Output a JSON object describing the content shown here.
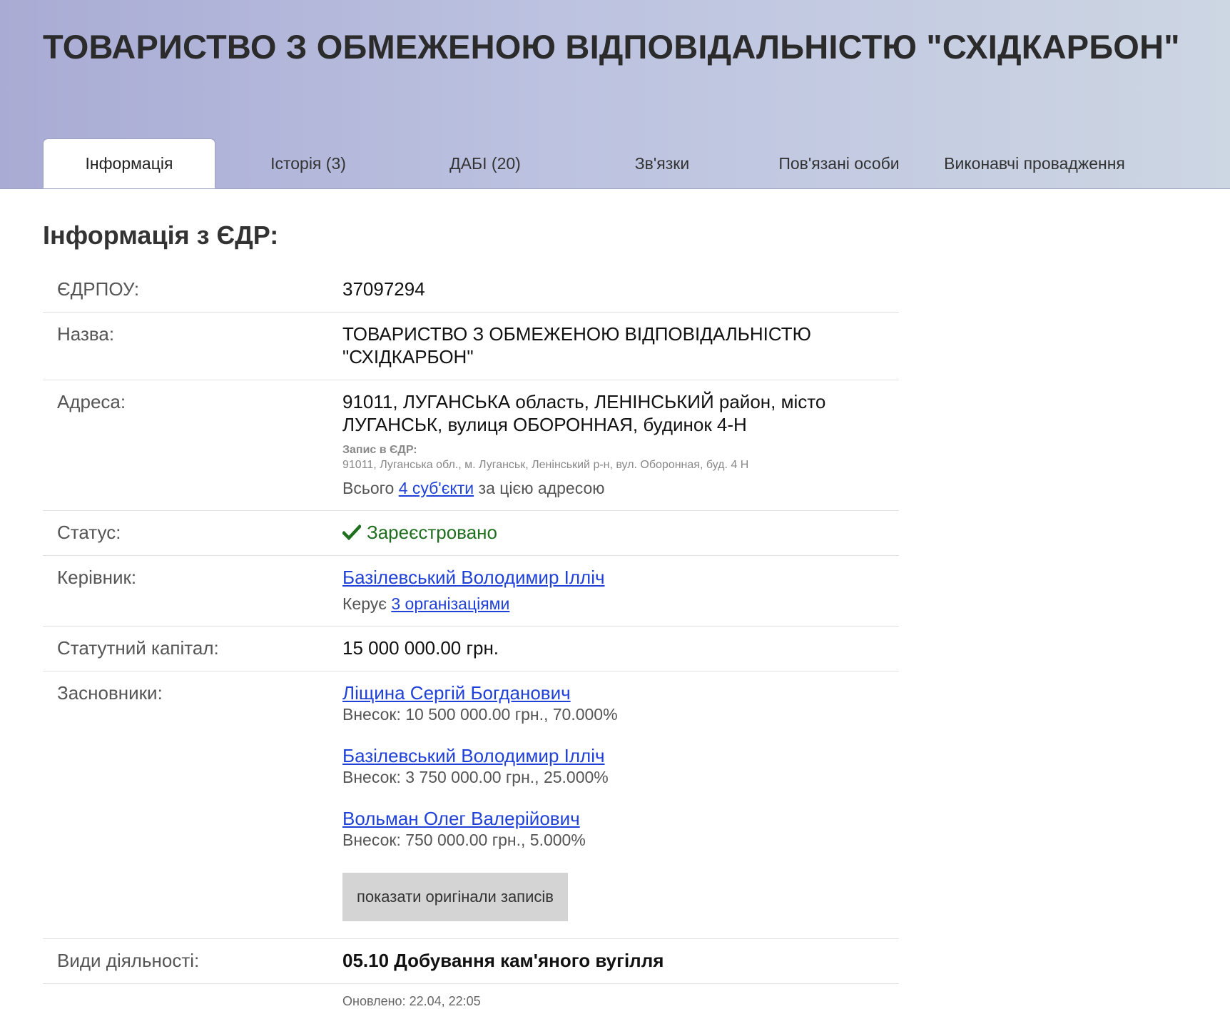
{
  "header": {
    "company_title": "ТОВАРИСТВО З ОБМЕЖЕНОЮ ВІДПОВІДАЛЬНІСТЮ \"СХІДКАРБОН\""
  },
  "tabs": [
    {
      "label": "Інформація",
      "active": true
    },
    {
      "label": "Історія (3)",
      "active": false
    },
    {
      "label": "ДАБІ (20)",
      "active": false
    },
    {
      "label": "Зв'язки",
      "active": false
    },
    {
      "label": "Пов'язані особи",
      "active": false
    },
    {
      "label": "Виконавчі провадження",
      "active": false
    }
  ],
  "section": {
    "title": "Інформація з ЄДР:"
  },
  "rows": {
    "edrpou": {
      "label": "ЄДРПОУ:",
      "value": "37097294"
    },
    "name": {
      "label": "Назва:",
      "value": "ТОВАРИСТВО З ОБМЕЖЕНОЮ ВІДПОВІДАЛЬНІСТЮ \"СХІДКАРБОН\""
    },
    "address": {
      "label": "Адреса:",
      "value": "91011, ЛУГАНСЬКА область, ЛЕНІНСЬКИЙ район, місто ЛУГАНСЬК, вулиця ОБОРОННАЯ, будинок 4-Н",
      "record_label": "Запис в ЄДР:",
      "record_value": "91011, Луганська обл., м. Луганськ, Ленінський р-н, вул. Оборонная, буд. 4 Н",
      "total_prefix": "Всього",
      "total_link": "4 суб'єкти",
      "total_suffix": "за цією адресою"
    },
    "status": {
      "label": "Статус:",
      "value": "Зареєстровано",
      "icon": "check-icon",
      "color": "#1f6f1f"
    },
    "director": {
      "label": "Керівник:",
      "name": "Базілевський Володимир Ілліч",
      "manages_prefix": "Керує",
      "manages_link": "3 організаціями"
    },
    "capital": {
      "label": "Статутний капітал:",
      "value": "15 000 000.00 грн."
    },
    "founders": {
      "label": "Засновники:",
      "items": [
        {
          "name": "Ліщина Сергій Богданович",
          "share": "Внесок: 10 500 000.00 грн., 70.000%"
        },
        {
          "name": "Базілевський Володимир Ілліч",
          "share": "Внесок: 3 750 000.00 грн., 25.000%"
        },
        {
          "name": "Вольман Олег Валерійович",
          "share": "Внесок: 750 000.00 грн., 5.000%"
        }
      ],
      "button_label": "показати оригінали записів"
    },
    "activities": {
      "label": "Види діяльності:",
      "value": "05.10 Добування кам'яного вугілля"
    }
  },
  "footer": {
    "updated": "Оновлено: 22.04, 22:05"
  },
  "colors": {
    "link": "#2041d8",
    "status_ok": "#1f6f1f",
    "header_gradient_start": "#a9abd4",
    "header_gradient_end": "#cdd6e3"
  }
}
